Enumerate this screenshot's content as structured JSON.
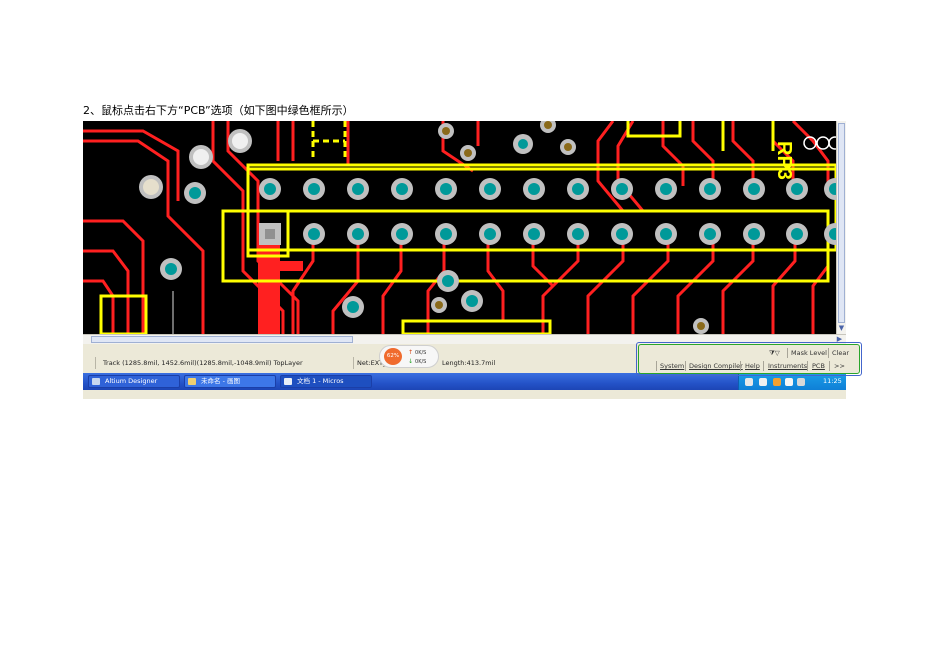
{
  "caption": "2、鼠标点击右下方“PCB”选项（如下图中绿色框所示）",
  "pcb": {
    "component_label": "RP3"
  },
  "status_bar": {
    "track_info": "Track (1285.8mil, 1452.6mil)(1285.8mil,-1048.9mil)  TopLayer",
    "net_info": "Net:EXT_D",
    "length_info": "Length:413.7mil"
  },
  "zoom_widget": {
    "percent": "62%",
    "up_rate": "0K/S",
    "down_rate": "0K/S"
  },
  "panel_controls": {
    "mask_level": "Mask Level",
    "clear": "Clear",
    "tabs": [
      "System",
      "Design Compiler",
      "Help",
      "Instruments",
      "PCB",
      ">>"
    ]
  },
  "taskbar": {
    "items": [
      "Altium Designer",
      "未命名 - 画图",
      "文档 1 - Micros"
    ],
    "clock": "11:25"
  },
  "colors": {
    "highlight_box": "#2aa52a",
    "trace": "#ff2020",
    "silkscreen": "#ffff00",
    "pad": "#009999"
  }
}
